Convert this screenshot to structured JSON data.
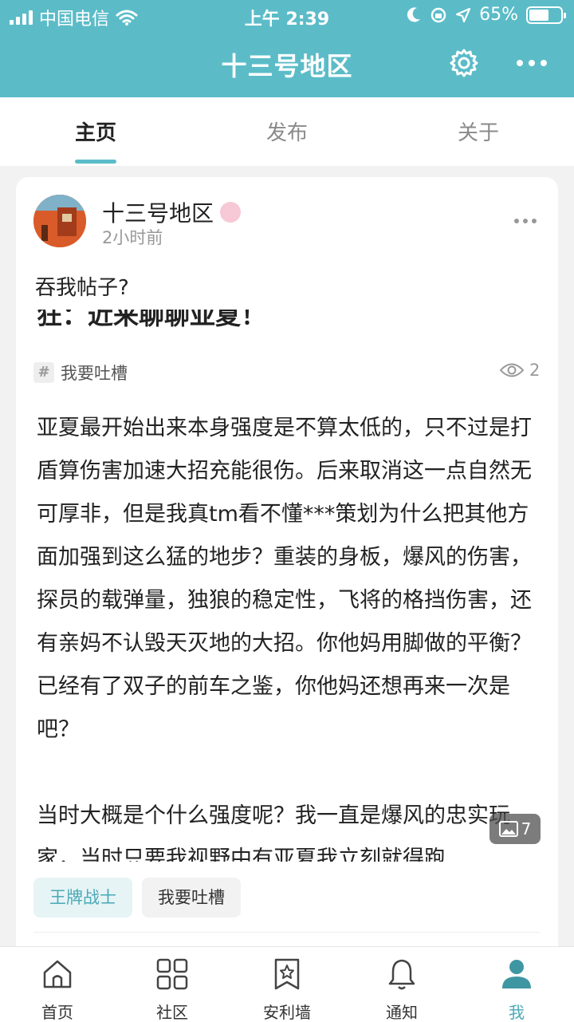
{
  "status_bar": {
    "carrier": "中国电信",
    "time": "上午 2:39",
    "battery": "65%"
  },
  "header": {
    "title": "十三号地区",
    "settings_icon": "gear-icon",
    "more_icon": "more-horizontal-icon"
  },
  "tabs": [
    {
      "label": "主页",
      "active": true
    },
    {
      "label": "发布",
      "active": false
    },
    {
      "label": "关于",
      "active": false
    }
  ],
  "post": {
    "author": "十三号地区",
    "time": "2小时前",
    "title": "吞我帖子?",
    "subtitle_partial": "狂：近来聊聊亚夏！",
    "topic": "我要吐槽",
    "view_count": "2",
    "body": "亚夏最开始出来本身强度是不算太低的，只不过是打盾算伤害加速大招充能很伤。后来取消这一点自然无可厚非，但是我真tm看不懂***策划为什么把其他方面加强到这么猛的地步？重装的身板，爆风的伤害，探员的载弹量，独狼的稳定性，飞将的格挡伤害，还有亲妈不认毁天灭地的大招。你他妈用脚做的平衡？已经有了双子的前车之鉴，你他妈还想再来一次是吧？\n\n当时大概是个什么强度呢？我一直是爆风的忠实玩家，当时只要我视野中有亚夏我立刻就得跑",
    "image_count": "7",
    "tags": [
      "王牌战士",
      "我要吐槽"
    ]
  },
  "bottom_nav": [
    {
      "label": "首页",
      "icon": "home-icon",
      "active": false
    },
    {
      "label": "社区",
      "icon": "grid-icon",
      "active": false
    },
    {
      "label": "安利墙",
      "icon": "bookmark-star-icon",
      "active": false
    },
    {
      "label": "通知",
      "icon": "bell-icon",
      "active": false
    },
    {
      "label": "我",
      "icon": "user-icon",
      "active": true
    }
  ],
  "colors": {
    "accent": "#5bbcc8",
    "accent_text": "#4aa9b6"
  }
}
